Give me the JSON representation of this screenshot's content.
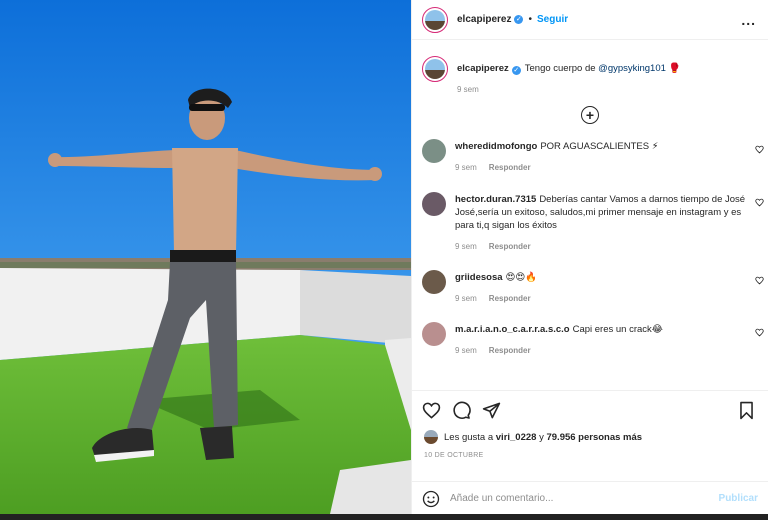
{
  "header": {
    "username": "elcapiperez",
    "separator": "•",
    "follow_label": "Seguir",
    "more_label": "..."
  },
  "caption": {
    "username": "elcapiperez",
    "text_before": "Tengo cuerpo de ",
    "mention": "@gypsyking101",
    "emoji": "🥊",
    "time": "9 sem"
  },
  "load_more_label": "+",
  "comments": [
    {
      "username": "wheredidmofongo",
      "text": "POR AGUASCALIENTES ⚡",
      "time": "9 sem",
      "reply": "Responder",
      "avatar_color": "#7b8f86"
    },
    {
      "username": "hector.duran.7315",
      "text": "Deberías cantar Vamos a darnos tiempo de José José,sería un exitoso, saludos,mi primer mensaje en instagram y es para ti,q sigan los éxitos",
      "time": "9 sem",
      "reply": "Responder",
      "avatar_color": "#6a5a66"
    },
    {
      "username": "griidesosa",
      "text": "😍😍🔥",
      "time": "9 sem",
      "reply": "Responder",
      "avatar_color": "#6b5a4a"
    },
    {
      "username": "m.a.r.i.a.n.o_c.a.r.r.a.s.c.o",
      "text": "Capi eres un crack😂",
      "time": "9 sem",
      "reply": "Responder",
      "avatar_color": "#b98f8f"
    }
  ],
  "likes": {
    "prefix": "Les gusta a ",
    "user": "viri_0228",
    "middle": " y ",
    "count": "79.956 personas más"
  },
  "date": "10 DE OCTUBRE",
  "add_comment": {
    "placeholder": "Añade un comentario...",
    "post_label": "Publicar"
  },
  "colors": {
    "accent": "#0095f6",
    "verified": "#3897f0",
    "sky": "#1b84e8",
    "grass": "#5fae2e"
  }
}
